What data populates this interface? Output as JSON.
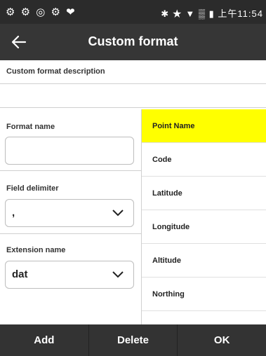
{
  "status_bar": {
    "left_icons": "⚙ ⚙ ◎ ⚙ ❤",
    "right_icons": "✱ ★ ▼ ▒ ▮",
    "time": "上午11:54"
  },
  "header": {
    "title": "Custom format",
    "back_icon": "arrow-left-icon"
  },
  "form": {
    "description_label": "Custom format description",
    "description_value": "",
    "format_name_label": "Format name",
    "format_name_value": "",
    "field_delimiter_label": "Field delimiter",
    "field_delimiter_value": ",",
    "extension_name_label": "Extension name",
    "extension_name_value": "dat"
  },
  "field_list": {
    "items": [
      {
        "label": "Point Name",
        "selected": true
      },
      {
        "label": "Code",
        "selected": false
      },
      {
        "label": "Latitude",
        "selected": false
      },
      {
        "label": "Longitude",
        "selected": false
      },
      {
        "label": "Altitude",
        "selected": false
      },
      {
        "label": "Northing",
        "selected": false
      }
    ]
  },
  "bottom_bar": {
    "add_label": "Add",
    "delete_label": "Delete",
    "ok_label": "OK"
  },
  "colors": {
    "selected": "#ffff00",
    "header_bg": "#363636",
    "bottom_bar_bg": "#333333"
  }
}
